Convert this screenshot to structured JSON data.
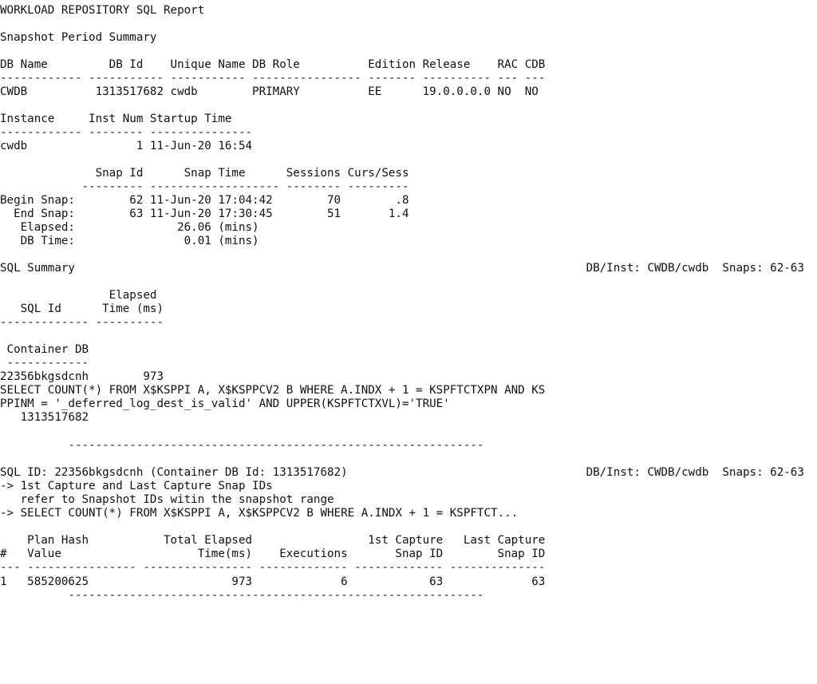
{
  "report": {
    "title": "WORKLOAD REPOSITORY SQL Report",
    "snapshot_period_summary": {
      "heading": "Snapshot Period Summary",
      "db_table": {
        "headers": [
          "DB Name",
          "DB Id",
          "Unique Name",
          "DB Role",
          "Edition",
          "Release",
          "RAC",
          "CDB"
        ],
        "dashes": [
          "------------",
          "-----------",
          "-----------",
          "----------------",
          "-------",
          "----------",
          "---",
          "---"
        ],
        "row": [
          "CWDB",
          "1313517682",
          "cwdb",
          "PRIMARY",
          "EE",
          "19.0.0.0.0",
          "NO",
          "NO"
        ]
      },
      "instance_table": {
        "headers": [
          "Instance",
          "Inst Num",
          "Startup Time"
        ],
        "dashes": [
          "------------",
          "--------",
          "---------------"
        ],
        "row": [
          "cwdb",
          "1",
          "11-Jun-20 16:54"
        ]
      },
      "snap_table": {
        "headers": [
          "Snap Id",
          "Snap Time",
          "Sessions",
          "Curs/Sess"
        ],
        "dashes": [
          "---------",
          "-------------------",
          "--------",
          "---------"
        ],
        "rows": [
          {
            "label": "Begin Snap:",
            "snap_id": "62",
            "snap_time": "11-Jun-20 17:04:42",
            "sessions": "70",
            "curs_sess": ".8"
          },
          {
            "label": "End Snap:",
            "snap_id": "63",
            "snap_time": "11-Jun-20 17:30:45",
            "sessions": "51",
            "curs_sess": "1.4"
          }
        ],
        "elapsed": {
          "label": "Elapsed:",
          "value": "26.06 (mins)"
        },
        "db_time": {
          "label": "DB Time:",
          "value": "0.01 (mins)"
        }
      }
    },
    "sql_summary": {
      "heading": "SQL Summary",
      "context": "DB/Inst: CWDB/cwdb  Snaps: 62-63",
      "headers_line1": [
        "Elapsed"
      ],
      "headers_line2": [
        "SQL Id",
        "Time (ms)"
      ],
      "dashes": [
        "-------------",
        "----------"
      ],
      "container_header": "Container DB",
      "container_dashes": "------------",
      "row": {
        "sql_id": "22356bkgsdcnh",
        "elapsed_ms": "973",
        "sql_text_line1": "SELECT COUNT(*) FROM X$KSPPI A, X$KSPPCV2 B WHERE A.INDX + 1 = KSPFTCTXPN AND KS",
        "sql_text_line2": "PPINM = '_deferred_log_dest_is_valid' AND UPPER(KSPFTCTXVL)='TRUE'",
        "container_db_id": "1313517682"
      },
      "separator": "-------------------------------------------------------------"
    },
    "sql_detail": {
      "heading": "SQL ID: 22356bkgsdcnh (Container DB Id: 1313517682)",
      "context": "DB/Inst: CWDB/cwdb  Snaps: 62-63",
      "notes": [
        "-> 1st Capture and Last Capture Snap IDs",
        "   refer to Snapshot IDs witin the snapshot range",
        "-> SELECT COUNT(*) FROM X$KSPPI A, X$KSPPCV2 B WHERE A.INDX + 1 = KSPFTCT..."
      ],
      "plan_table": {
        "headers_line1": [
          "Plan Hash",
          "Total Elapsed",
          "1st Capture",
          "Last Capture"
        ],
        "headers_line2": [
          "#",
          "Value",
          "Time(ms)",
          "Executions",
          "Snap ID",
          "Snap ID"
        ],
        "dashes": [
          "---",
          "----------------",
          "----------------",
          "-------------",
          "-------------",
          "--------------"
        ],
        "rows": [
          {
            "num": "1",
            "plan_hash_value": "585200625",
            "total_elapsed_ms": "973",
            "executions": "6",
            "first_capture_snap_id": "63",
            "last_capture_snap_id": "63"
          }
        ]
      },
      "separator": "-------------------------------------------------------------"
    }
  }
}
